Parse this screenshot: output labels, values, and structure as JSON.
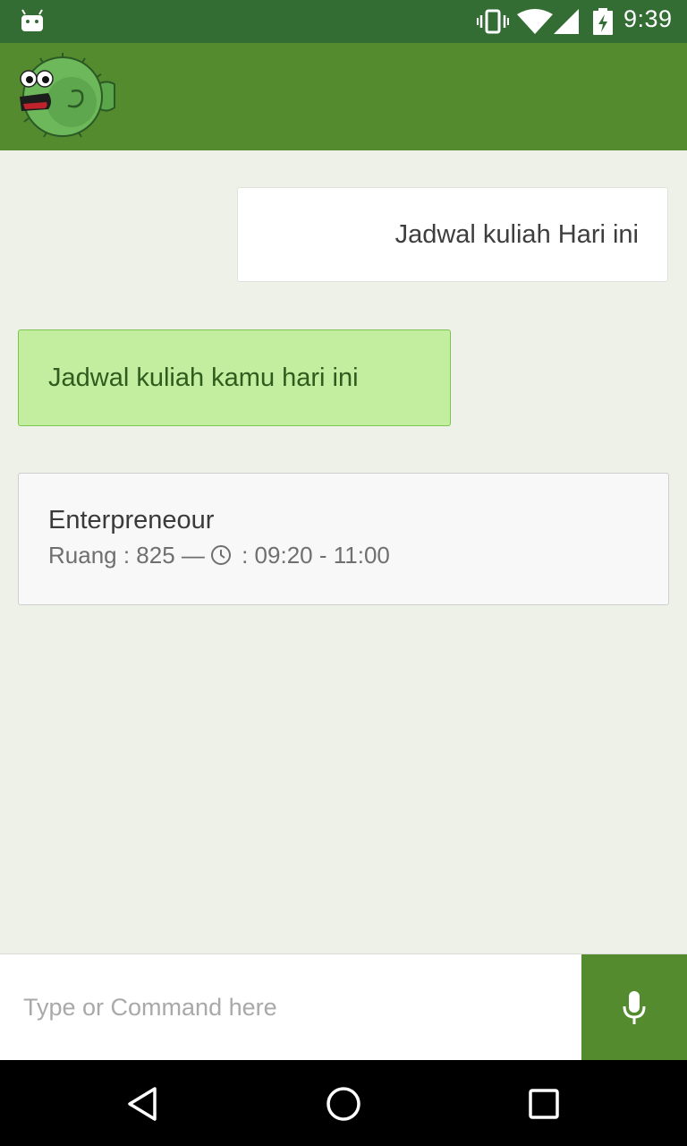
{
  "status_bar": {
    "time": "9:39",
    "icons": [
      "android-debug-icon",
      "vibrate-icon",
      "wifi-icon",
      "signal-icon",
      "battery-charging-icon"
    ]
  },
  "app_bar": {
    "logo": "pufferfish-logo"
  },
  "chat": {
    "user_message": "Jadwal kuliah Hari ini",
    "bot_message": "Jadwal kuliah kamu hari ini",
    "schedule_card": {
      "course": "Enterpreneour",
      "room_text": "Ruang : 825 —",
      "time_text": " : 09:20 - 11:00"
    }
  },
  "input": {
    "placeholder": "Type or Command here",
    "value": ""
  },
  "colors": {
    "status_bar": "#336d34",
    "app_bar": "#558b2f",
    "background": "#edf1e8",
    "bot_bubble": "#c3eea0",
    "bot_bubble_border": "#7cc452"
  },
  "nav_bar": {
    "buttons": [
      "back-icon",
      "home-icon",
      "recents-icon"
    ]
  }
}
